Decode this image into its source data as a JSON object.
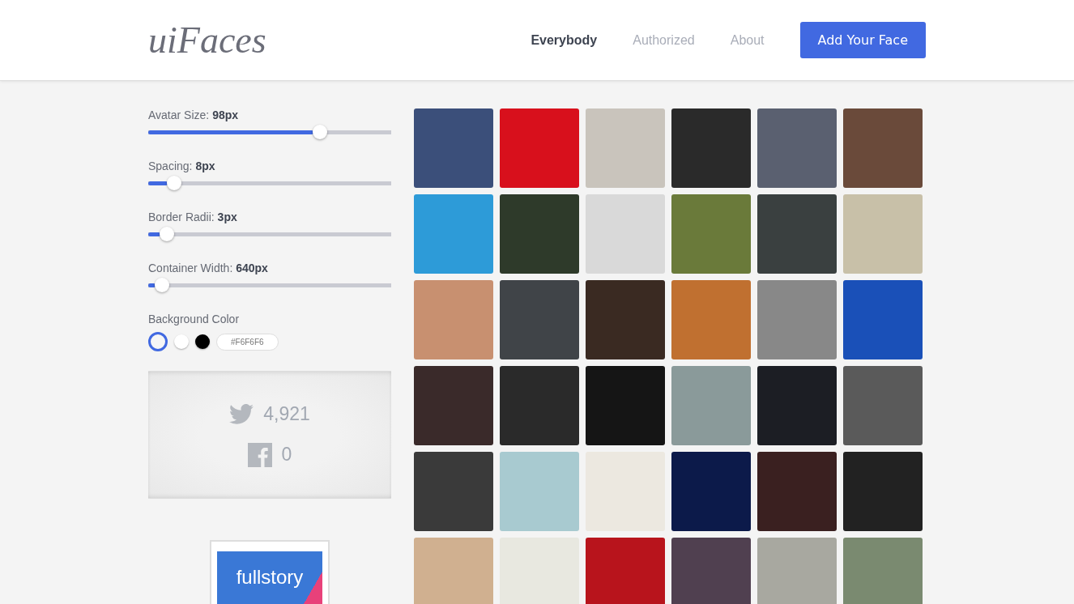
{
  "header": {
    "logo": "uiFaces",
    "nav": [
      {
        "label": "Everybody",
        "selected": true
      },
      {
        "label": "Authorized",
        "selected": false
      },
      {
        "label": "About",
        "selected": false
      }
    ],
    "cta": "Add Your Face"
  },
  "controls": {
    "sliders": [
      {
        "label": "Avatar Size: **98px**",
        "level": 0.72
      },
      {
        "label": "Spacing: **8px**",
        "level": 0.08
      },
      {
        "label": "Border Radii: **3px**",
        "level": 0.05
      },
      {
        "label": "Container Width: **640px**",
        "level": 0.03
      }
    ],
    "background": {
      "label": "Background Color",
      "swatches": [
        {
          "color": "#f6f6f6",
          "selected": true
        },
        {
          "color": "#ffffff",
          "selected": false
        },
        {
          "color": "#000000",
          "selected": false
        }
      ],
      "value": "#F6F6F6"
    }
  },
  "shares": [
    {
      "kind": "twitter",
      "count": "4,921"
    },
    {
      "kind": "facebook",
      "count": "0"
    }
  ],
  "ad": {
    "text": "fullstory"
  },
  "avatars": [
    {
      "color": "#3b4f7a"
    },
    {
      "color": "#d8101c"
    },
    {
      "color": "#c9c4bc"
    },
    {
      "color": "#2a2a2a"
    },
    {
      "color": "#5a6070"
    },
    {
      "color": "#6a4a3a"
    },
    {
      "color": "#2d9bd8"
    },
    {
      "color": "#2e3a2a"
    },
    {
      "color": "#d9d9d9"
    },
    {
      "color": "#6a7a3a"
    },
    {
      "color": "#3a4040"
    },
    {
      "color": "#c8c0a8"
    },
    {
      "color": "#c89070"
    },
    {
      "color": "#404448"
    },
    {
      "color": "#3a2a22"
    },
    {
      "color": "#c07030"
    },
    {
      "color": "#888888"
    },
    {
      "color": "#1a50b8"
    },
    {
      "color": "#3a2a2a"
    },
    {
      "color": "#2a2a2a"
    },
    {
      "color": "#151515"
    },
    {
      "color": "#8a9a9a"
    },
    {
      "color": "#1c1e24"
    },
    {
      "color": "#5a5a5a"
    },
    {
      "color": "#3a3a3a"
    },
    {
      "color": "#a8cad0"
    },
    {
      "color": "#ece8e0"
    },
    {
      "color": "#0c1a4a"
    },
    {
      "color": "#3a2020"
    },
    {
      "color": "#222222"
    },
    {
      "color": "#d0b090"
    },
    {
      "color": "#e8e8e0"
    },
    {
      "color": "#b8141c"
    },
    {
      "color": "#504050"
    },
    {
      "color": "#a8a8a0"
    },
    {
      "color": "#7a8a70"
    }
  ]
}
